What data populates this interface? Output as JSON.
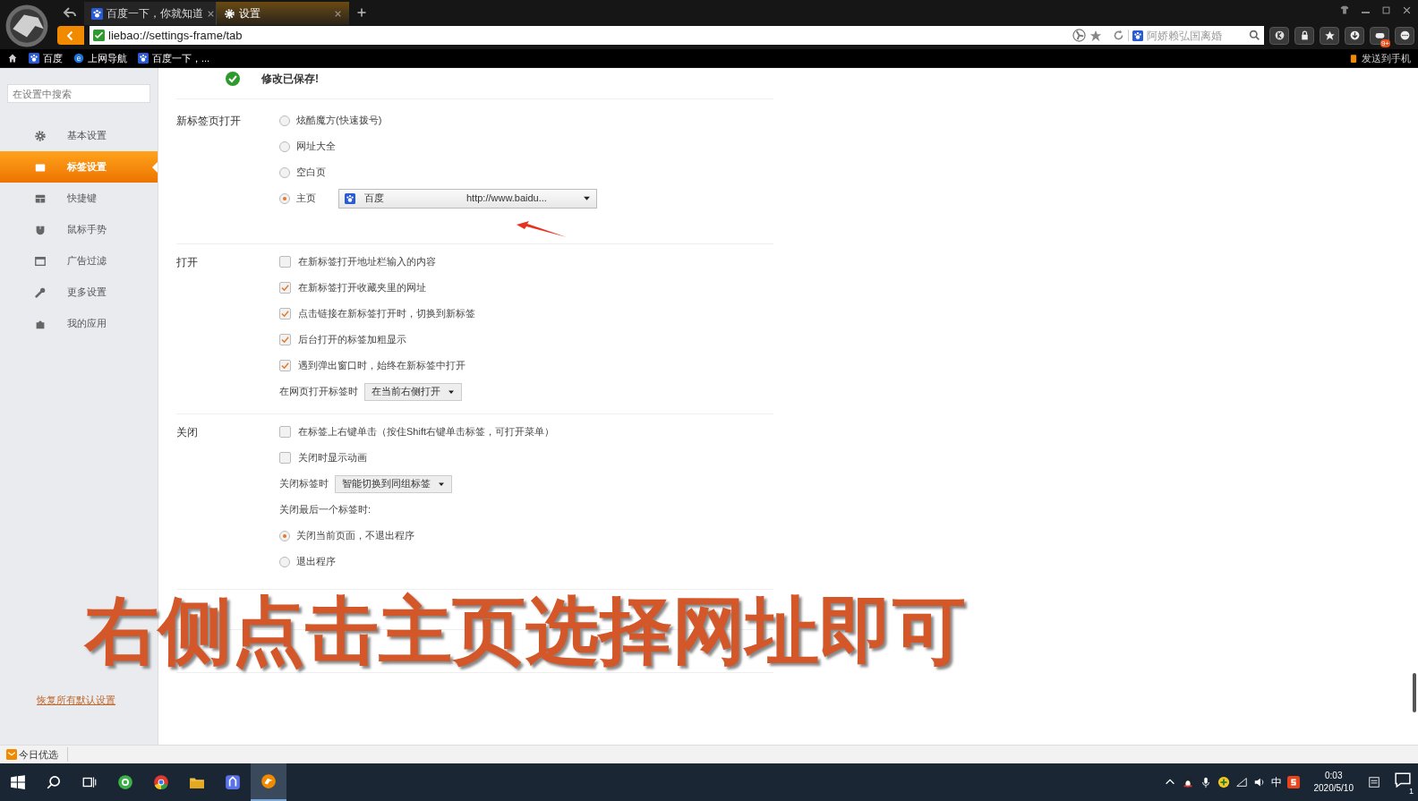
{
  "browser": {
    "tabs": [
      {
        "label": "百度一下，你就知道",
        "selected": false,
        "kind": "paw"
      },
      {
        "label": "设置",
        "selected": true,
        "kind": "gear"
      }
    ],
    "url": "liebao://settings-frame/tab",
    "search_placeholder": "阿娇赖弘国离婚",
    "badge": "9+",
    "bookmarks": [
      {
        "label": "百度",
        "kind": "paw"
      },
      {
        "label": "上网导航",
        "kind": "e"
      },
      {
        "label": "百度一下，...",
        "kind": "paw"
      }
    ],
    "send_to_phone": "发送到手机"
  },
  "sidebar": {
    "search_placeholder": "在设置中搜索",
    "items": [
      {
        "label": "基本设置",
        "selected": false
      },
      {
        "label": "标签设置",
        "selected": true
      },
      {
        "label": "快捷键",
        "selected": false
      },
      {
        "label": "鼠标手势",
        "selected": false
      },
      {
        "label": "广告过滤",
        "selected": false
      },
      {
        "label": "更多设置",
        "selected": false
      },
      {
        "label": "我的应用",
        "selected": false
      }
    ],
    "restore_link": "恢复所有默认设置"
  },
  "saved_notice": "修改已保存!",
  "sections": [
    {
      "label": "新标签页打开",
      "rows": [
        {
          "kind": "radio",
          "label": "炫酷魔方(快速拨号)",
          "selected": false
        },
        {
          "kind": "radio",
          "label": "网址大全",
          "selected": false
        },
        {
          "kind": "radio",
          "label": "空白页",
          "selected": false
        },
        {
          "kind": "radio",
          "label": "主页",
          "selected": true,
          "select": {
            "name": "百度",
            "url": "http://www.baidu..."
          }
        }
      ]
    },
    {
      "label": "打开",
      "rows": [
        {
          "kind": "checkbox",
          "label": "在新标签打开地址栏输入的内容",
          "checked": false
        },
        {
          "kind": "checkbox",
          "label": "在新标签打开收藏夹里的网址",
          "checked": true
        },
        {
          "kind": "checkbox",
          "label": "点击链接在新标签打开时，切换到新标签",
          "checked": true
        },
        {
          "kind": "checkbox",
          "label": "后台打开的标签加粗显示",
          "checked": true
        },
        {
          "kind": "checkbox",
          "label": "遇到弹出窗口时，始终在新标签中打开",
          "checked": true
        },
        {
          "kind": "dropdown",
          "label": "在网页打开标签时",
          "value": "在当前右侧打开"
        }
      ]
    },
    {
      "label": "关闭",
      "rows": [
        {
          "kind": "checkbox",
          "label": "在标签上右键单击（按住Shift右键单击标签，可打开菜单）",
          "checked": false
        },
        {
          "kind": "checkbox",
          "label": "关闭时显示动画",
          "checked": false
        },
        {
          "kind": "dropdown",
          "label": "关闭标签时",
          "value": "智能切换到同组标签"
        },
        {
          "kind": "text",
          "label": "关闭最后一个标签时:"
        },
        {
          "kind": "radio",
          "label": "关闭当前页面，不退出程序",
          "selected": true
        },
        {
          "kind": "radio",
          "label": "退出程序",
          "selected": false
        }
      ]
    }
  ],
  "status_bar": {
    "label": "今日优选"
  },
  "taskbar": {
    "ime": "中",
    "time": "0:03",
    "date": "2020/5/10",
    "notification_count": "1"
  },
  "caption": "右侧点击主页选择网址即可"
}
